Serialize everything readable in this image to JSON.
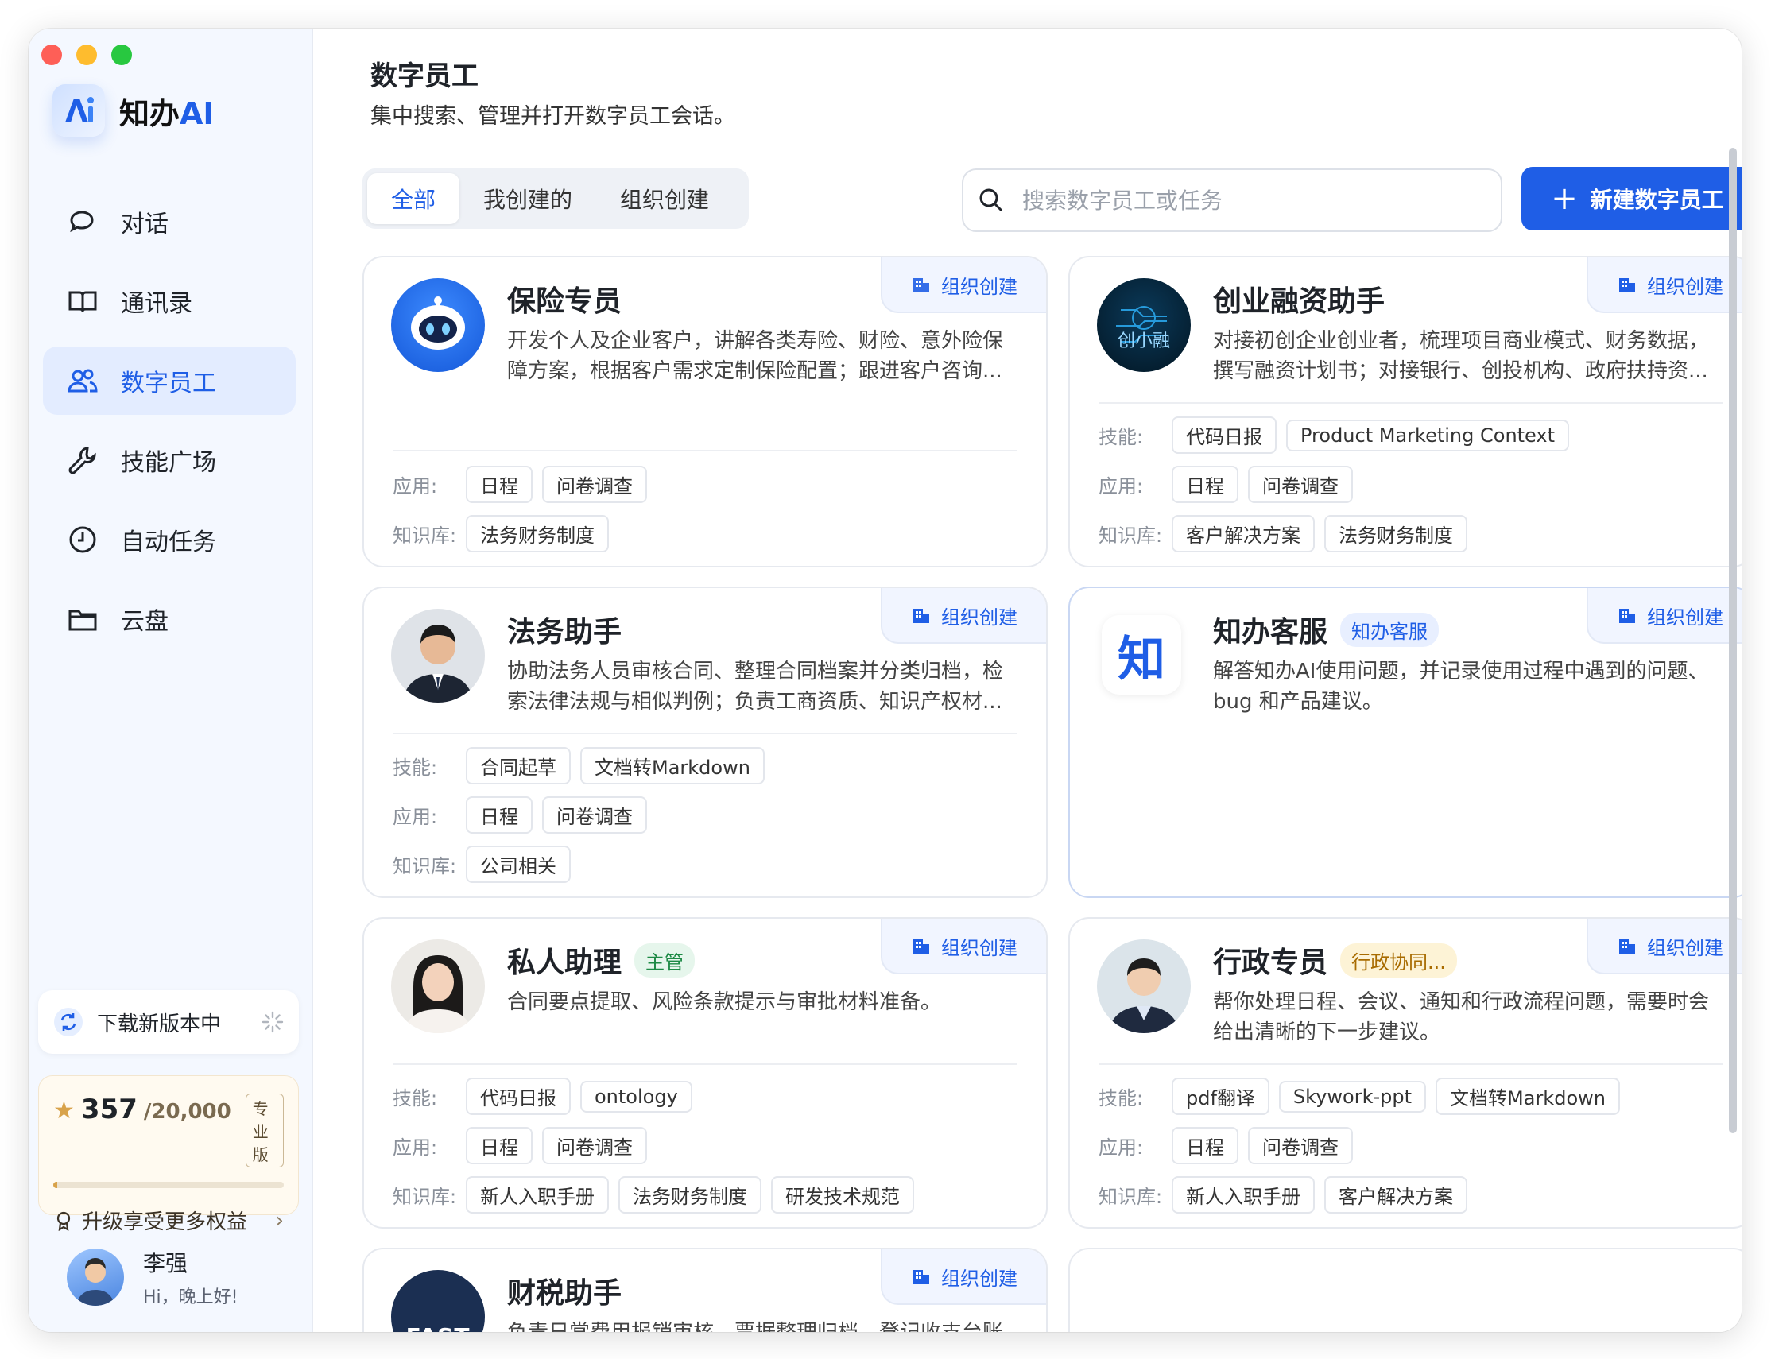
{
  "app": {
    "name_main": "知办",
    "name_ai": "AI"
  },
  "nav": [
    {
      "label": "对话",
      "icon": "chat-icon"
    },
    {
      "label": "通讯录",
      "icon": "book-icon"
    },
    {
      "label": "数字员工",
      "icon": "users-icon",
      "active": true
    },
    {
      "label": "技能广场",
      "icon": "wrench-icon"
    },
    {
      "label": "自动任务",
      "icon": "clock-icon"
    },
    {
      "label": "云盘",
      "icon": "folder-icon"
    }
  ],
  "download": {
    "label": "下载新版本中"
  },
  "points": {
    "current": "357",
    "max": "/20,000",
    "plan": "专业版",
    "progress": 0.018,
    "upgrade": "升级享受更多权益"
  },
  "user": {
    "name": "李强",
    "greeting": "Hi，晚上好!"
  },
  "page": {
    "title": "数字员工",
    "subtitle": "集中搜索、管理并打开数字员工会话。"
  },
  "tabs": [
    "全部",
    "我创建的",
    "组织创建"
  ],
  "search": {
    "placeholder": "搜索数字员工或任务"
  },
  "new_button": "新建数字员工",
  "labels": {
    "skills": "技能:",
    "apps": "应用:",
    "kb": "知识库:"
  },
  "cards": [
    {
      "name": "保险专员",
      "tag": "组织创建",
      "desc": "开发个人及企业客户，讲解各类寿险、财险、意外险保\n障方案，根据客户需求定制保险配置；跟进客户咨询...",
      "apps": [
        "日程",
        "问卷调查"
      ],
      "kb": [
        "法务财务制度"
      ]
    },
    {
      "name": "创业融资助手",
      "tag": "组织创建",
      "desc": "对接初创企业创业者，梳理项目商业模式、财务数据，\n撰写融资计划书；对接银行、创投机构、政府扶持资...",
      "skills": [
        "代码日报",
        "Product Marketing Context"
      ],
      "apps": [
        "日程",
        "问卷调查"
      ],
      "kb": [
        "客户解决方案",
        "法务财务制度"
      ]
    },
    {
      "name": "法务助手",
      "tag": "组织创建",
      "desc": "协助法务人员审核合同、整理合同档案并分类归档，检\n索法律法规与相似判例；负责工商资质、知识产权材...",
      "skills": [
        "合同起草",
        "文档转Markdown"
      ],
      "apps": [
        "日程",
        "问卷调查"
      ],
      "kb": [
        "公司相关"
      ]
    },
    {
      "name": "知办客服",
      "badge": "知办客服",
      "tag": "组织创建",
      "desc": "解答知办AI使用问题，并记录使用过程中遇到的问题、\nbug 和产品建议。",
      "avatar_char": "知"
    },
    {
      "name": "私人助理",
      "badge": "主管",
      "tag": "组织创建",
      "desc": "合同要点提取、风险条款提示与审批材料准备。",
      "skills": [
        "代码日报",
        "ontology"
      ],
      "apps": [
        "日程",
        "问卷调查"
      ],
      "kb": [
        "新人入职手册",
        "法务财务制度",
        "研发技术规范"
      ]
    },
    {
      "name": "行政专员",
      "badge": "行政协同...",
      "tag": "组织创建",
      "desc": "帮你处理日程、会议、通知和行政流程问题，需要时会\n给出清晰的下一步建议。",
      "skills": [
        "pdf翻译",
        "Skywork-ppt",
        "文档转Markdown"
      ],
      "apps": [
        "日程",
        "问卷调查"
      ],
      "kb": [
        "新人入职手册",
        "客户解决方案"
      ]
    },
    {
      "name": "财税助手",
      "tag": "组织创建",
      "desc": "负责日常费用报销审核、票据整理归档、登记收支台账",
      "avatar_text": "FAST"
    }
  ],
  "colors": {
    "accent": "#1f5ee6",
    "green_badge_bg": "#e6f6ec",
    "green_badge_fg": "#1d8a45",
    "yellow_badge_bg": "#fdf3d6",
    "yellow_badge_fg": "#a86b00"
  }
}
